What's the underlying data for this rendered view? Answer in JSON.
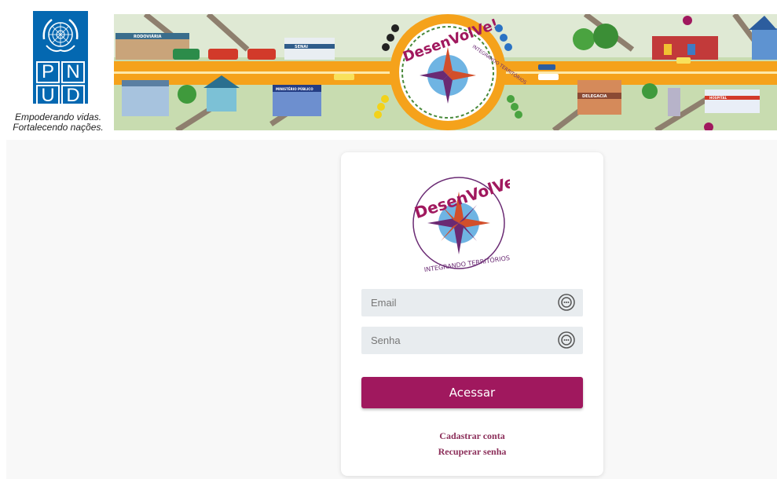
{
  "header": {
    "undp_letters": [
      "P",
      "N",
      "U",
      "D"
    ],
    "tagline_line1": "Empoderando vidas.",
    "tagline_line2": "Fortalecendo nações."
  },
  "banner": {
    "logo_word": "DesenVolVe!",
    "logo_sub": "INTEGRANDO TERRITÓRIOS",
    "building_labels": [
      "RODOVIÁRIA",
      "SENAI",
      "MINISTÉRIO PÚBLICO",
      "DELEGACIA",
      "HOSPITAL"
    ]
  },
  "login": {
    "logo_word": "DesenVolVe!",
    "logo_sub": "INTEGRANDO TERRITÓRIOS",
    "email_placeholder": "Email",
    "senha_placeholder": "Senha",
    "submit_label": "Acessar",
    "register_link": "Cadastrar conta",
    "recover_link": "Recuperar senha"
  },
  "colors": {
    "brand": "#a0185e",
    "undp_blue": "#0468b1",
    "field_bg": "#e8ecef",
    "link": "#8c2f5a"
  },
  "icons": [
    "un-emblem-icon",
    "password-manager-icon",
    "compass-rose-icon"
  ]
}
